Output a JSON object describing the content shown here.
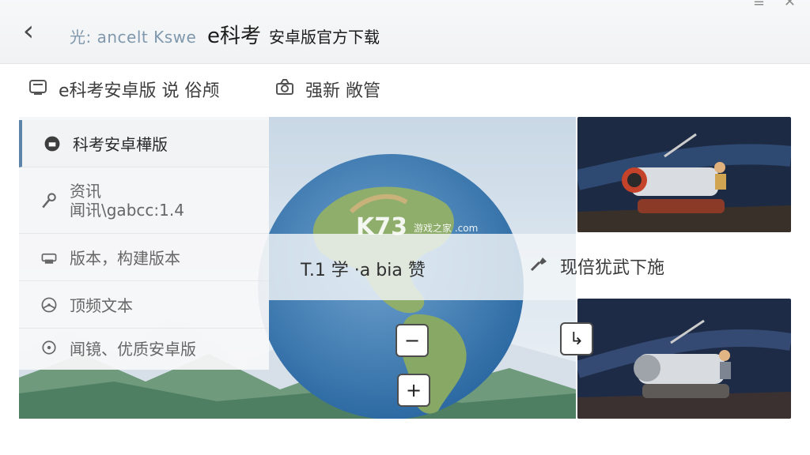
{
  "header": {
    "back_label": "‹",
    "brand": "光: ancelt Kswe",
    "title_main": "e科考",
    "title_sub": "安卓版官方下载",
    "status_icons": [
      "volume-icon",
      "menu-icon",
      "signal-icon"
    ]
  },
  "toolbar": {
    "items": [
      {
        "label": "e科考安卓版 说 俗颅",
        "icon": "box-icon"
      },
      {
        "label": "强新 敞管",
        "icon": "camera-icon"
      }
    ]
  },
  "side_menu": {
    "items": [
      {
        "label": "科考安卓樺版",
        "icon": "info-circle-icon",
        "active": true
      },
      {
        "label": "资讯 / 闻讯\\gabcc:1.4",
        "line1": "资讯",
        "line2": "闻讯\\gabcc:1.4",
        "icon": "key-icon"
      },
      {
        "label": "版本，构建版本",
        "icon": "printer-icon"
      },
      {
        "label": "顶频文本",
        "icon": "steering-icon"
      },
      {
        "label": "闻镜、优质安卓版",
        "icon": "target-icon"
      }
    ]
  },
  "center": {
    "text": "T.1  学 ·a bia 赞",
    "right_action": "现倍犹武下施",
    "right_icon": "tools-icon"
  },
  "watermark": {
    "main": "K73",
    "sub": "游戏之家\n.com"
  },
  "floating_buttons": [
    {
      "name": "minus-button",
      "symbol": "−"
    },
    {
      "name": "plus-button",
      "symbol": "+"
    },
    {
      "name": "share-button",
      "symbol": "↳"
    }
  ],
  "colors": {
    "accent": "#5b84a8",
    "brand": "#7f98ad",
    "text_dark": "#222222"
  }
}
